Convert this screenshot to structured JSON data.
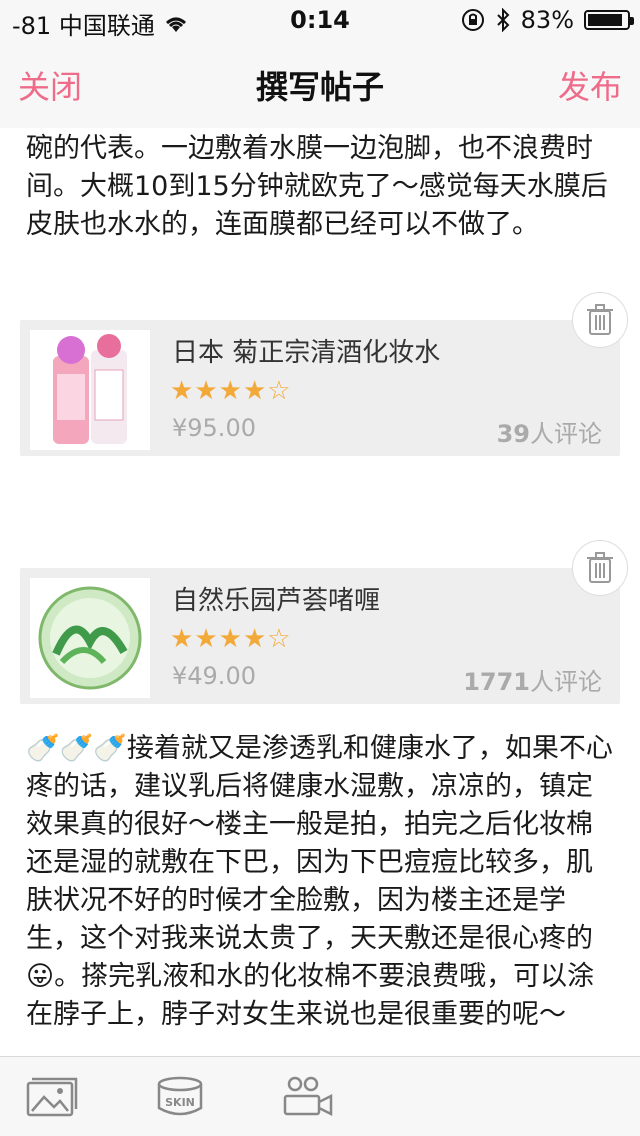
{
  "status_bar": {
    "carrier": "-81 中国联通",
    "time": "0:14",
    "battery": "83%"
  },
  "nav": {
    "close": "关闭",
    "title": "撰写帖子",
    "publish": "发布"
  },
  "content": {
    "paragraph1": "碗的代表。一边敷着水膜一边泡脚，也不浪费时间。大概10到15分钟就欧克了～感觉每天水膜后皮肤也水水的，连面膜都已经可以不做了。",
    "paragraph2": "接着就又是渗透乳和健康水了，如果不心疼的话，建议乳后将健康水湿敷，凉凉的，镇定效果真的很好～楼主一般是拍，拍完之后化妆棉还是湿的就敷在下巴，因为下巴痘痘比较多，肌肤状况不好的时候才全脸敷，因为楼主还是学生，这个对我来说太贵了，天天敷还是很心疼的",
    "paragraph2_tail": "。搽完乳液和水的化妆棉不要浪费哦，可以涂在脖子上，脖子对女生来说也是很重要的呢～",
    "bottle_emoji": "🍼🍼🍼",
    "tongue_emoji": "😛"
  },
  "products": [
    {
      "name": "日本 菊正宗清酒化妆水",
      "rating": 4,
      "max_rating": 5,
      "price": "¥95.00",
      "review_count": "39",
      "review_suffix": "人评论"
    },
    {
      "name": "自然乐园芦荟啫喱",
      "rating": 4,
      "max_rating": 5,
      "price": "¥49.00",
      "review_count": "1771",
      "review_suffix": "人评论"
    }
  ],
  "icons": {
    "trash": "trash-icon",
    "photo": "photo-icon",
    "skin": "skin-icon",
    "people": "people-icon"
  },
  "skin_label": "SKIN",
  "colors": {
    "accent": "#ef6b8a",
    "star": "#f2a93a",
    "card_bg": "#eeeeee",
    "bar_bg": "#f7f7f7"
  }
}
